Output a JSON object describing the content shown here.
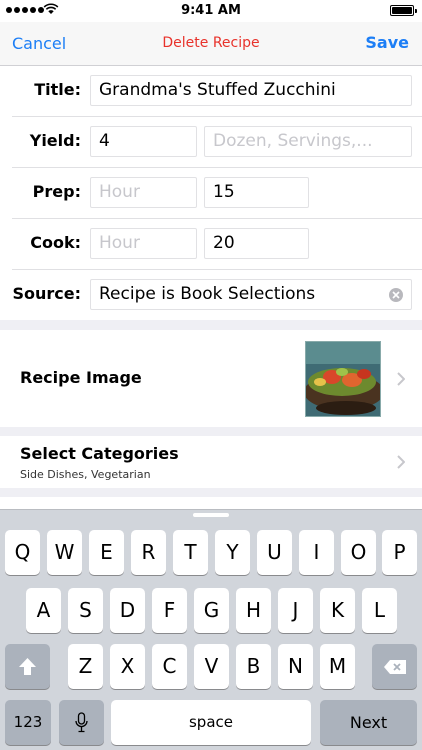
{
  "status_bar": {
    "time": "9:41 AM"
  },
  "nav": {
    "cancel": "Cancel",
    "title": "Delete Recipe",
    "save": "Save"
  },
  "form": {
    "title_label": "Title:",
    "title_value": "Grandma's Stuffed Zucchini",
    "yield_label": "Yield:",
    "yield_value": "4",
    "yield_unit_placeholder": "Dozen, Servings,...",
    "prep_label": "Prep:",
    "prep_hour_placeholder": "Hour",
    "prep_minutes": "15",
    "cook_label": "Cook:",
    "cook_hour_placeholder": "Hour",
    "cook_minutes": "20",
    "source_label": "Source:",
    "source_value": "Recipe is Book Selections"
  },
  "recipe_image": {
    "label": "Recipe Image"
  },
  "categories": {
    "title": "Select Categories",
    "selected": "Side Dishes, Vegetarian"
  },
  "keyboard": {
    "row1": [
      "Q",
      "W",
      "E",
      "R",
      "T",
      "Y",
      "U",
      "I",
      "O",
      "P"
    ],
    "row2": [
      "A",
      "S",
      "D",
      "F",
      "G",
      "H",
      "J",
      "K",
      "L"
    ],
    "row3": [
      "Z",
      "X",
      "C",
      "V",
      "B",
      "N",
      "M"
    ],
    "numbers_key": "123",
    "space_key": "space",
    "return_key": "Next"
  },
  "colors": {
    "tint": "#1c7ef6",
    "destructive": "#e8322b",
    "placeholder": "#c7c7cc",
    "background": "#efeff4",
    "keyboard": "#d1d5db"
  },
  "icons": [
    "signal-dots-icon",
    "wifi-icon",
    "battery-icon",
    "clear-text-icon",
    "chevron-right-icon",
    "shift-icon",
    "delete-backspace-icon",
    "microphone-icon"
  ]
}
